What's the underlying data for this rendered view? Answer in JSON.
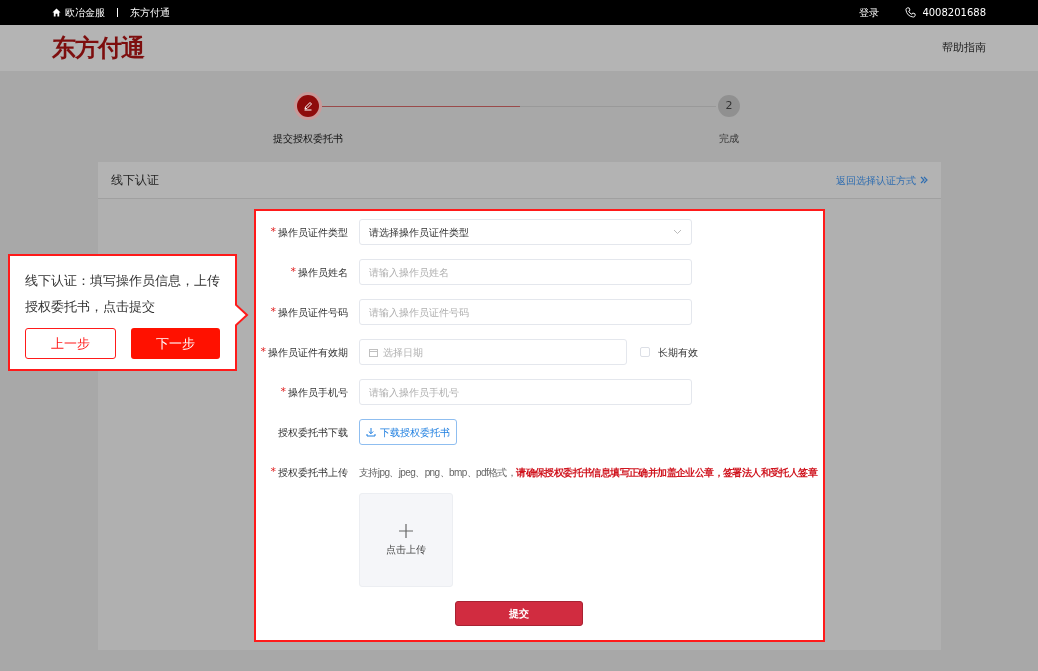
{
  "top_bar": {
    "home_link": "欧冶金服",
    "brand_link": "东方付通",
    "login": "登录",
    "phone": "4008201688"
  },
  "header": {
    "logo": "东方付通",
    "help": "帮助指南"
  },
  "steps": [
    {
      "label": "提交授权委托书",
      "active": true
    },
    {
      "number": "2",
      "label": "完成",
      "active": false
    }
  ],
  "card": {
    "title": "线下认证",
    "back_link": "返回选择认证方式"
  },
  "form": {
    "fields": [
      {
        "kind": "select",
        "label": "操作员证件类型",
        "required_mark": "*",
        "value": "请选择操作员证件类型"
      },
      {
        "kind": "input",
        "label": "操作员姓名",
        "required_mark": "*",
        "placeholder": "请输入操作员姓名"
      },
      {
        "kind": "input",
        "label": "操作员证件号码",
        "required_mark": "*",
        "placeholder": "请输入操作员证件号码"
      },
      {
        "kind": "date",
        "label": "操作员证件有效期",
        "required_mark": "*",
        "placeholder": "选择日期",
        "checkbox": {
          "label": "长期有效",
          "checked": false
        }
      },
      {
        "kind": "input",
        "label": "操作员手机号",
        "required_mark": "*",
        "placeholder": "请输入操作员手机号"
      },
      {
        "kind": "download",
        "label": "授权委托书下载",
        "button": "下载授权委托书"
      },
      {
        "kind": "upload",
        "label": "授权委托书上传",
        "required_mark": "*",
        "hint": "支持jpg、jpeg、png、bmp、pdf格式，",
        "warning": "请确保授权委托书信息填写正确并加盖企业公章，签署法人和受托人签章",
        "upload": "点击上传"
      }
    ],
    "submit": "提交"
  },
  "tour": {
    "text": "线下认证：填写操作员信息，上传授权委托书，点击提交",
    "prev": "上一步",
    "next": "下一步"
  }
}
